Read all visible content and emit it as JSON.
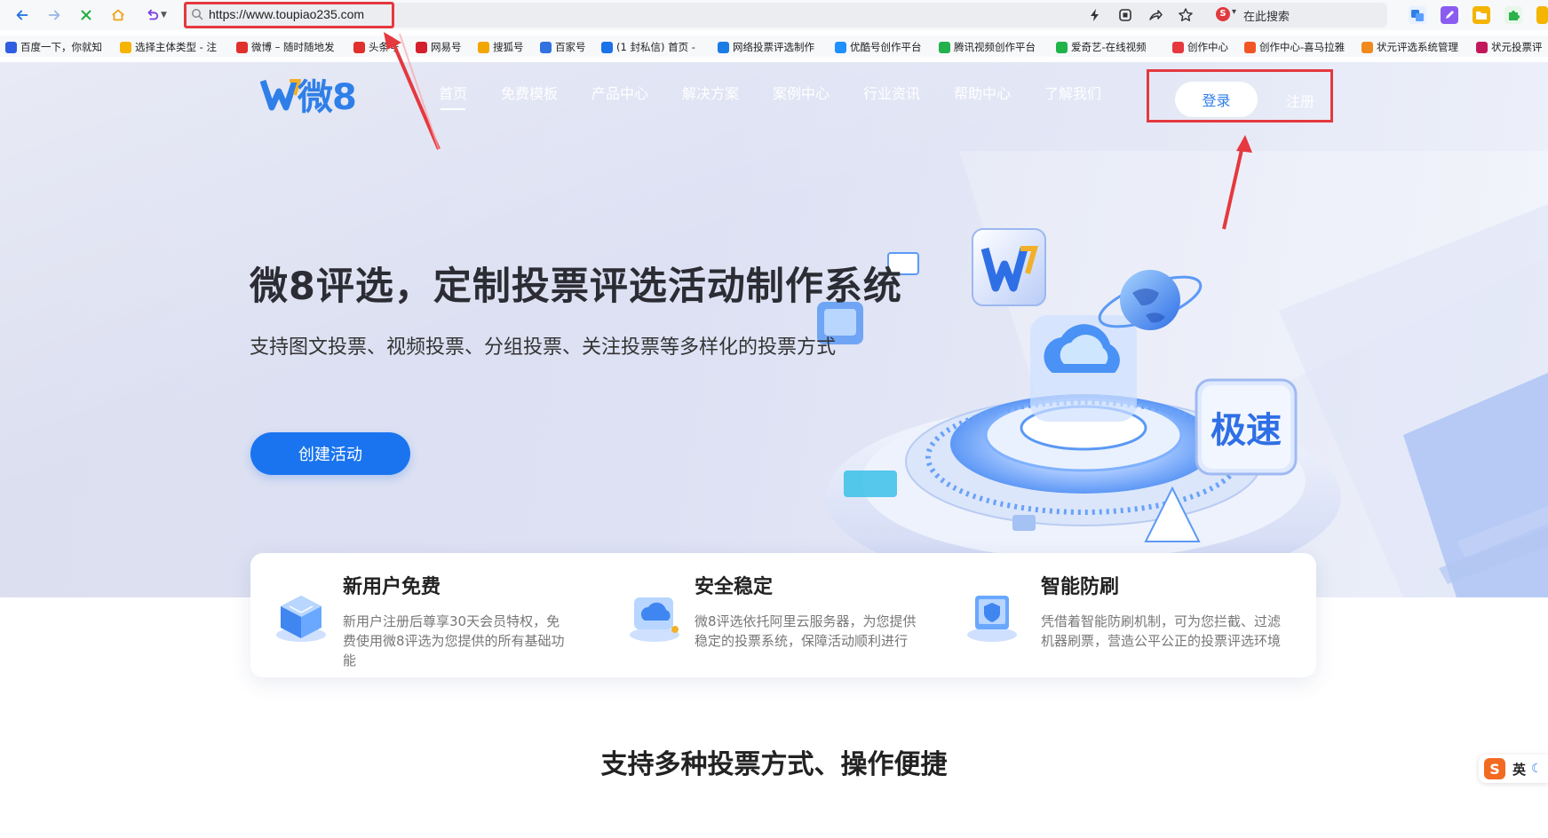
{
  "browser": {
    "url": "https://www.toupiao235.com",
    "search_placeholder": "在此搜索",
    "engine_badge": "S"
  },
  "bookmarks": [
    {
      "label": "百度一下，你就知",
      "color": "#2f5fe0"
    },
    {
      "label": "选择主体类型 - 注",
      "color": "#f5b400"
    },
    {
      "label": "微博 – 随时随地发",
      "color": "#e0312c"
    },
    {
      "label": "头条号",
      "color": "#e0312c"
    },
    {
      "label": "网易号",
      "color": "#d4202c"
    },
    {
      "label": "搜狐号",
      "color": "#f2a600"
    },
    {
      "label": "百家号",
      "color": "#3171e0"
    },
    {
      "label": "(1 封私信) 首页 -",
      "color": "#1a73e8"
    },
    {
      "label": "网络投票评选制作",
      "color": "#1c7ce6"
    },
    {
      "label": "优酷号创作平台",
      "color": "#1e90ff"
    },
    {
      "label": "腾讯视频创作平台",
      "color": "#22b14c"
    },
    {
      "label": "爱奇艺-在线视频",
      "color": "#1fb34a"
    },
    {
      "label": "创作中心",
      "color": "#e5383f"
    },
    {
      "label": "创作中心-喜马拉雅",
      "color": "#f25624"
    },
    {
      "label": "状元评选系统管理",
      "color": "#f08a1c"
    },
    {
      "label": "状元投票评",
      "color": "#c2185b"
    }
  ],
  "site": {
    "logo_text": "微8",
    "nav": [
      "首页",
      "免费模板",
      "产品中心",
      "解决方案",
      "案例中心",
      "行业资讯",
      "帮助中心",
      "了解我们"
    ],
    "login": "登录",
    "register": "注册"
  },
  "hero": {
    "title": "微8评选，定制投票评选活动制作系统",
    "subtitle": "支持图文投票、视频投票、分组投票、关注投票等多样化的投票方式",
    "cta": "创建活动",
    "badge_text": "极速"
  },
  "features": [
    {
      "title": "新用户免费",
      "desc": "新用户注册后尊享30天会员特权，免费使用微8评选为您提供的所有基础功能"
    },
    {
      "title": "安全稳定",
      "desc": "微8评选依托阿里云服务器，为您提供稳定的投票系统，保障活动顺利进行"
    },
    {
      "title": "智能防刷",
      "desc": "凭借着智能防刷机制，可为您拦截、过滤机器刷票，营造公平公正的投票评选环境"
    }
  ],
  "section_title": "支持多种投票方式、操作便捷",
  "ime": {
    "logo": "S",
    "lang": "英",
    "moon": "☾"
  },
  "colors": {
    "accent": "#1a74ef",
    "annotation": "#e5383f",
    "logo_blue": "#2f7fe8"
  }
}
